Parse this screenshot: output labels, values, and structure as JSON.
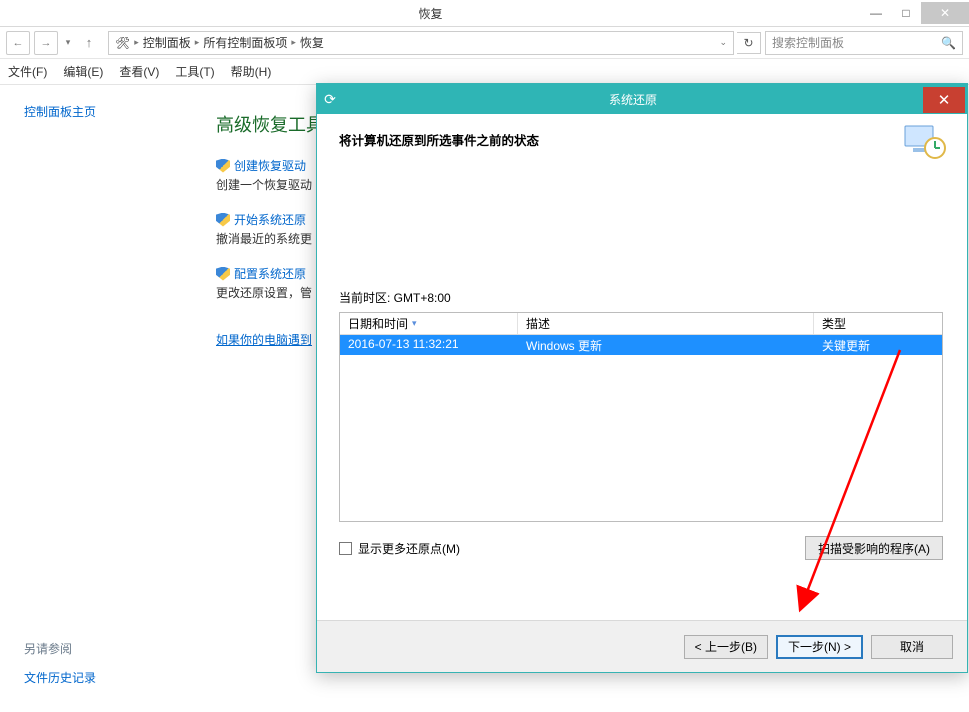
{
  "window": {
    "title": "恢复",
    "nav": {
      "breadcrumb": [
        "控制面板",
        "所有控制面板项",
        "恢复"
      ],
      "search_placeholder": "搜索控制面板"
    },
    "menu": [
      "文件(F)",
      "编辑(E)",
      "查看(V)",
      "工具(T)",
      "帮助(H)"
    ]
  },
  "left": {
    "home": "控制面板主页",
    "see_also_label": "另请参阅",
    "see_also_link": "文件历史记录"
  },
  "main": {
    "heading": "高级恢复工具",
    "items": [
      {
        "link": "创建恢复驱动",
        "desc": "创建一个恢复驱动"
      },
      {
        "link": "开始系统还原",
        "desc": "撤消最近的系统更"
      },
      {
        "link": "配置系统还原",
        "desc": "更改还原设置，管"
      }
    ],
    "trouble": "如果你的电脑遇到"
  },
  "dialog": {
    "title": "系统还原",
    "heading": "将计算机还原到所选事件之前的状态",
    "timezone_label": "当前时区: GMT+8:00",
    "columns": {
      "datetime": "日期和时间",
      "desc": "描述",
      "type": "类型"
    },
    "row": {
      "datetime": "2016-07-13 11:32:21",
      "desc": "Windows 更新",
      "type": "关键更新"
    },
    "show_more": "显示更多还原点(M)",
    "scan_btn": "扫描受影响的程序(A)",
    "buttons": {
      "back": "< 上一步(B)",
      "next": "下一步(N) >",
      "cancel": "取消"
    }
  }
}
